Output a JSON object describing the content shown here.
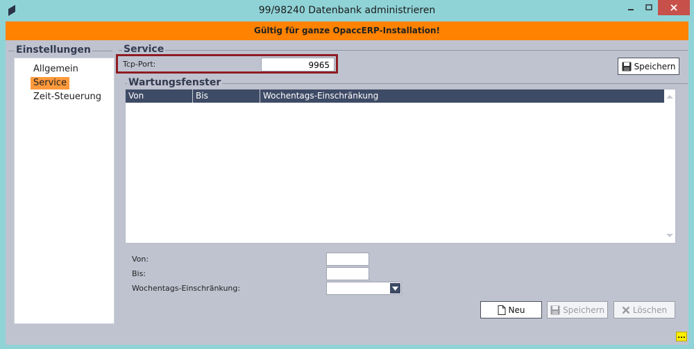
{
  "window": {
    "title": "99/98240 Datenbank administrieren",
    "minimize_glyph": "—",
    "maximize_glyph": "☐",
    "close_glyph": "✕"
  },
  "banner": {
    "text": "Gültig für ganze OpaccERP-Installation!"
  },
  "sidebar": {
    "title": "Einstellungen",
    "items": [
      {
        "label": "Allgemein",
        "active": false
      },
      {
        "label": "Service",
        "active": true
      },
      {
        "label": "Zeit-Steuerung",
        "active": false
      }
    ]
  },
  "service": {
    "title": "Service",
    "tcp_port_label": "Tcp-Port:",
    "tcp_port_value": "9965",
    "save_label": "Speichern"
  },
  "maintenance": {
    "title": "Wartungsfenster",
    "columns": [
      "Von",
      "Bis",
      "Wochentags-Einschränkung"
    ],
    "rows": [],
    "form": {
      "von_label": "Von:",
      "bis_label": "Bis:",
      "weekday_label": "Wochentags-Einschränkung:",
      "von_value": "",
      "bis_value": "",
      "weekday_value": ""
    },
    "buttons": {
      "new_label": "Neu",
      "save_label": "Speichern",
      "delete_label": "Löschen"
    }
  },
  "status": {
    "indicator": "..."
  },
  "colors": {
    "frame": "#8fd3d7",
    "banner": "#ff8200",
    "panel": "#bfc3d0",
    "grid_header": "#3e4b66",
    "active_item": "#ff9a3c",
    "highlight": "#8e1c22",
    "close": "#c7504b"
  }
}
